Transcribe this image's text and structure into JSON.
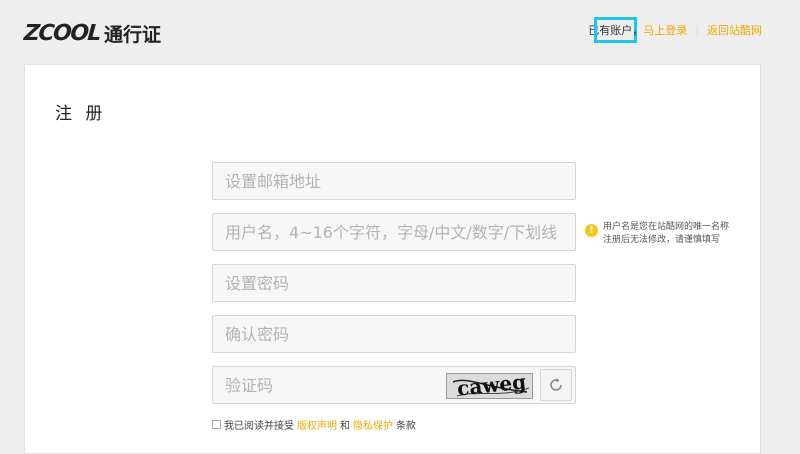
{
  "header": {
    "logo_text": "ZCOOL",
    "logo_sub": "通行证",
    "have_account_prefix": "已",
    "have_account_highlight": "有账户",
    "have_account_comma": "，",
    "login_link": "马上登录",
    "separator": "|",
    "back_link": "返回站酷网"
  },
  "form": {
    "title": "注 册",
    "email_placeholder": "设置邮箱地址",
    "username_placeholder": "用户名，4~16个字符，字母/中文/数字/下划线",
    "password_placeholder": "设置密码",
    "confirm_placeholder": "确认密码",
    "captcha_placeholder": "验证码",
    "captcha_text": "caweg"
  },
  "username_tip": {
    "icon": "warning-icon",
    "icon_glyph": "!",
    "text": "用户名是您在站酷网的唯一名称 注册后无法修改，请谨慎填写"
  },
  "agreement": {
    "prefix": "我已阅读并接受",
    "copyright_link": "版权声明",
    "and": "和",
    "privacy_link": "隐私保护",
    "suffix": "条款"
  },
  "colors": {
    "accent": "#f2a900",
    "highlight_box": "#1ec6ee"
  }
}
